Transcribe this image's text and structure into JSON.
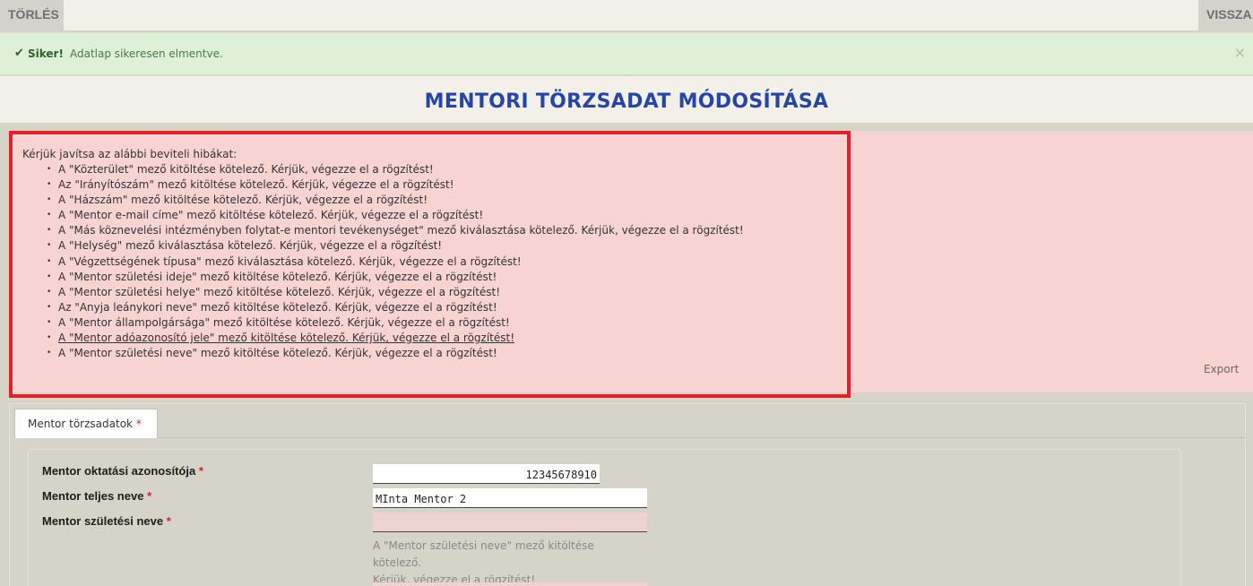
{
  "toolbar": {
    "delete_label": "TÖRLÉS",
    "back_label": "VISSZA"
  },
  "alert": {
    "icon": "check-icon",
    "strong": "Siker!",
    "message": "Adatlap sikeresen elmentve.",
    "close": "×"
  },
  "page_title": "MENTORI TÖRZSADAT MÓDOSÍTÁSA",
  "errors": {
    "intro": "Kérjük javítsa az alábbi beviteli hibákat:",
    "items": [
      "A \"Közterület\" mező kitöltése kötelező. Kérjük, végezze el a rögzítést!",
      "Az \"Irányítószám\" mező kitöltése kötelező. Kérjük, végezze el a rögzítést!",
      "A \"Házszám\" mező kitöltése kötelező. Kérjük, végezze el a rögzítést!",
      "A \"Mentor e-mail címe\" mező kitöltése kötelező. Kérjük, végezze el a rögzítést!",
      "A \"Más köznevelési intézményben folytat-e mentori tevékenységet\" mező kiválasztása kötelező. Kérjük, végezze el a rögzítést!",
      "A \"Helység\" mező kiválasztása kötelező. Kérjük, végezze el a rögzítést!",
      "A \"Végzettségének típusa\" mező kiválasztása kötelező. Kérjük, végezze el a rögzítést!",
      "A \"Mentor születési ideje\" mező kitöltése kötelező. Kérjük, végezze el a rögzítést!",
      "A \"Mentor születési helye\" mező kitöltése kötelező. Kérjük, végezze el a rögzítést!",
      "Az \"Anyja leánykori neve\" mező kitöltése kötelező. Kérjük, végezze el a rögzítést!",
      "A \"Mentor állampolgársága\" mező kitöltése kötelező. Kérjük, végezze el a rögzítést!",
      "A \"Mentor adóazonosító jele\" mező kitöltése kötelező. Kérjük, végezze el a rögzítést!",
      "A \"Mentor születési neve\" mező kitöltése kötelező. Kérjük, végezze el a rögzítést!"
    ],
    "export_label": "Export"
  },
  "tab": {
    "label": "Mentor törzsadatok",
    "required_mark": "*"
  },
  "form": {
    "required_mark": "*",
    "fields": [
      {
        "label": "Mentor oktatási azonosítója",
        "value": "12345678910"
      },
      {
        "label": "Mentor teljes neve",
        "value": "MInta Mentor 2"
      },
      {
        "label": "Mentor születési neve",
        "value": ""
      }
    ],
    "field_error_line1": "A \"Mentor születési neve\" mező kitöltése kötelező.",
    "field_error_line2": "Kérjük, végezze el a rögzítést!"
  }
}
